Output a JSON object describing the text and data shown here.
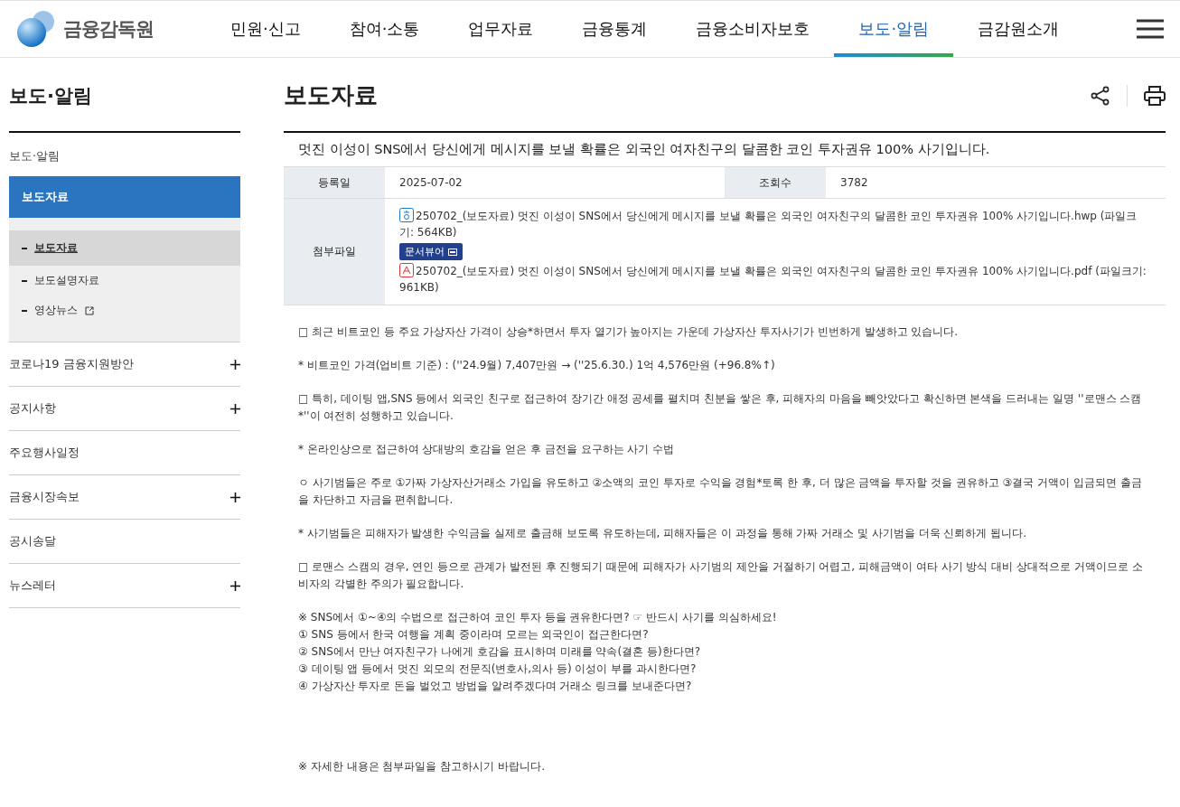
{
  "header": {
    "logo_text": "금융감독원",
    "nav": [
      {
        "label": "민원·신고",
        "selected": false
      },
      {
        "label": "참여·소통",
        "selected": false
      },
      {
        "label": "업무자료",
        "selected": false
      },
      {
        "label": "금융통계",
        "selected": false
      },
      {
        "label": "금융소비자보호",
        "selected": false
      },
      {
        "label": "보도·알림",
        "selected": true
      },
      {
        "label": "금감원소개",
        "selected": false
      }
    ]
  },
  "sidebar": {
    "title": "보도·알림",
    "section": "보도·알림",
    "active_item": "보도자료",
    "sub_items": [
      {
        "label": "보도자료",
        "selected": true,
        "external": false
      },
      {
        "label": "보도설명자료",
        "selected": false,
        "external": false
      },
      {
        "label": "영상뉴스",
        "selected": false,
        "external": true
      }
    ],
    "items": [
      {
        "label": "코로나19 금융지원방안",
        "expandable": true
      },
      {
        "label": "공지사항",
        "expandable": true
      },
      {
        "label": "주요행사일정",
        "expandable": false
      },
      {
        "label": "금융시장속보",
        "expandable": true
      },
      {
        "label": "공시송달",
        "expandable": false
      },
      {
        "label": "뉴스레터",
        "expandable": true
      }
    ]
  },
  "page_title": "보도자료",
  "article": {
    "title": "멋진 이성이 SNS에서 당신에게 메시지를 보낼 확률은 외국인 여자친구의 달콤한 코인 투자권유 100% 사기입니다.",
    "meta": [
      {
        "label": "등록일",
        "value": "2025-07-02"
      },
      {
        "label": "조회수",
        "value": "3782"
      }
    ],
    "attachments_label": "첨부파일",
    "attachments": [
      {
        "kind": "hwp",
        "name": "250702_(보도자료) 멋진 이성이 SNS에서 당신에게 메시지를 보낼 확률은 외국인 여자친구의 달콤한 코인 투자권유 100% 사기입니다.hwp (파일크기: 564KB)",
        "viewer": "문서뷰어"
      },
      {
        "kind": "pdf",
        "name": "250702_(보도자료) 멋진 이성이 SNS에서 당신에게 메시지를 보낼 확률은 외국인 여자친구의 달콤한 코인 투자권유 100% 사기입니다.pdf (파일크기: 961KB)"
      }
    ],
    "paragraphs": [
      {
        "kind": "normal",
        "lines": [
          "□ 최근 비트코인 등 주요 가상자산 가격이 상승*하면서 투자 열기가 높아지는 가운데 가상자산 투자사기가 빈번하게 발생하고 있습니다."
        ]
      },
      {
        "kind": "normal",
        "lines": [
          "* 비트코인 가격(업비트 기준) : (''24.9월) 7,407만원 → (''25.6.30.) 1억 4,576만원 (+96.8%↑)"
        ]
      },
      {
        "kind": "normal",
        "lines": [
          "□ 특히, 데이팅 앱,SNS 등에서 외국인 친구로 접근하여 장기간 애정 공세를 펼치며 친분을 쌓은 후, 피해자의 마음을 빼앗았다고 확신하면 본색을 드러내는 일명 ''로맨스 스캠*''이 여전히 성행하고 있습니다."
        ]
      },
      {
        "kind": "normal",
        "lines": [
          "* 온라인상으로 접근하여 상대방의 호감을 얻은 후 금전을 요구하는 사기 수법"
        ]
      },
      {
        "kind": "normal",
        "lines": [
          "ㅇ 사기범들은 주로 ①가짜 가상자산거래소 가입을 유도하고 ②소액의 코인 투자로 수익을 경험*토록 한 후, 더 많은 금액을 투자할 것을 권유하고 ③결국 거액이 입금되면 출금을 차단하고 자금을 편취합니다."
        ]
      },
      {
        "kind": "normal",
        "lines": [
          "* 사기범들은 피해자가 발생한 수익금을 실제로 출금해 보도록 유도하는데, 피해자들은 이 과정을 통해 가짜 거래소 및 사기범을 더욱 신뢰하게 됩니다."
        ]
      },
      {
        "kind": "normal",
        "lines": [
          "□ 로맨스 스캠의 경우, 연인 등으로 관계가 발전된 후 진행되기 때문에 피해자가 사기범의 제안을 거절하기 어렵고, 피해금액이 여타 사기 방식 대비 상대적으로 거액이므로 소비자의 각별한 주의가 필요합니다."
        ]
      },
      {
        "kind": "normal",
        "lines": [
          "※ SNS에서 ①~④의 수법으로 접근하여 코인 투자 등을 권유한다면? ☞ 반드시 사기를 의심하세요!",
          "① SNS 등에서 한국 여행을 계획 중이라며 모르는 외국인이 접근한다면?",
          "② SNS에서 만난 여자친구가 나에게 호감을 표시하며 미래를 약속(결혼 등)한다면?",
          "③ 데이팅 앱 등에서 멋진 외모의 전문직(변호사,의사 등) 이성이 부를 과시한다면?",
          "④ 가상자산 투자로 돈을 벌었고 방법을 알려주겠다며 거래소 링크를 보내준다면?"
        ]
      },
      {
        "kind": "closing",
        "lines": [
          "※ 자세한 내용은 첨부파일을 참고하시기 바랍니다."
        ]
      }
    ]
  }
}
